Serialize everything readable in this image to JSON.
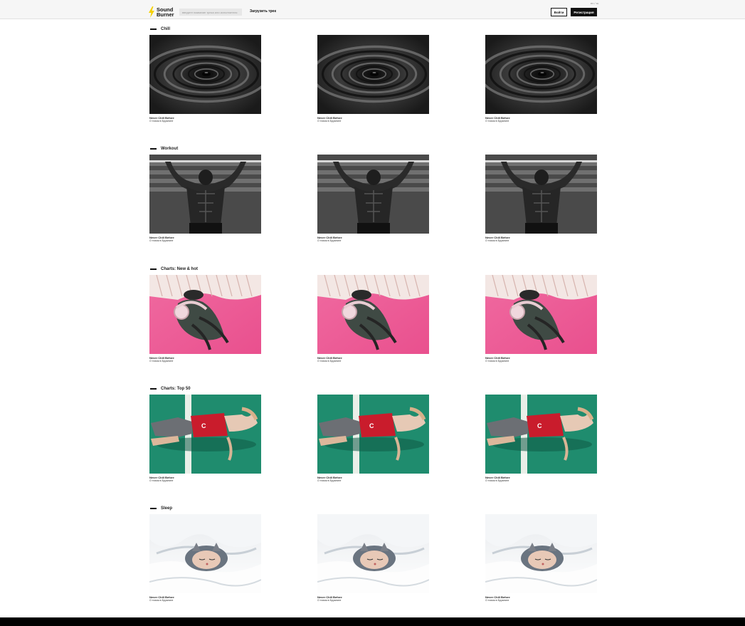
{
  "header": {
    "lang": "en / ru",
    "logo_line1": "Sound",
    "logo_line2": "Burner",
    "search_placeholder": "введите название трека или исполнителя",
    "upload_label": "Загрузить трек",
    "login_label": "Войти",
    "register_label": "Регистрация"
  },
  "colors": {
    "accent": "#f5d000",
    "header_bg": "#f6f6f6",
    "footer_bg": "#000000"
  },
  "sections": [
    {
      "title": "Chill",
      "image": "water-ripple-photo",
      "cards": [
        {
          "title": "Never Chill Before",
          "artist": "О тихом в Бруклине"
        },
        {
          "title": "Never Chill Before",
          "artist": "О тихом в Бруклине"
        },
        {
          "title": "Never Chill Before",
          "artist": "О тихом в Бруклине"
        }
      ]
    },
    {
      "title": "Workout",
      "image": "pullup-athlete-photo",
      "cards": [
        {
          "title": "Never Chill Before",
          "artist": "О тихом в Бруклине"
        },
        {
          "title": "Never Chill Before",
          "artist": "О тихом в Бруклине"
        },
        {
          "title": "Never Chill Before",
          "artist": "О тихом в Бруклине"
        }
      ]
    },
    {
      "title": "Charts: New & hot",
      "image": "headphones-pink-photo",
      "cards": [
        {
          "title": "Never Chill Before",
          "artist": "О тихом в Бруклине"
        },
        {
          "title": "Never Chill Before",
          "artist": "О тихом в Бруклине"
        },
        {
          "title": "Never Chill Before",
          "artist": "О тихом в Бруклине"
        }
      ]
    },
    {
      "title": "Charts: Top 50",
      "image": "track-lying-photo",
      "cards": [
        {
          "title": "Never Chill Before",
          "artist": "О тихом в Бруклине"
        },
        {
          "title": "Never Chill Before",
          "artist": "О тихом в Бруклине"
        },
        {
          "title": "Never Chill Before",
          "artist": "О тихом в Бруклине"
        }
      ]
    },
    {
      "title": "Sleep",
      "image": "cat-in-blanket-photo",
      "cards": [
        {
          "title": "Never Chill Before",
          "artist": "О тихом в Бруклине"
        },
        {
          "title": "Never Chill Before",
          "artist": "О тихом в Бруклине"
        },
        {
          "title": "Never Chill Before",
          "artist": "О тихом в Бруклине"
        }
      ]
    }
  ]
}
